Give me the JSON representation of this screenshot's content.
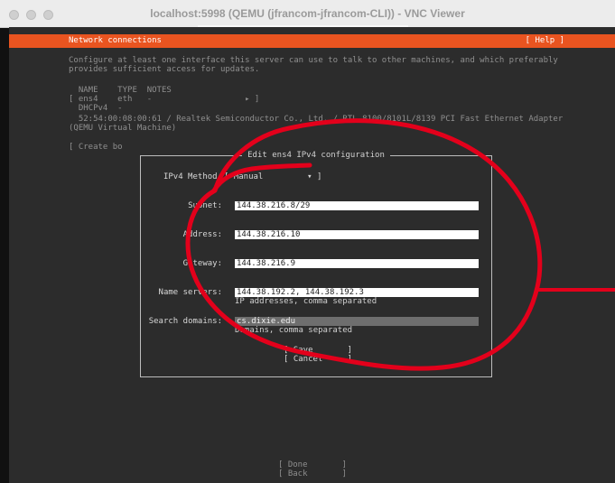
{
  "window": {
    "title": "localhost:5998 (QEMU (jfrancom-jfrancom-CLI)) - VNC Viewer"
  },
  "header": {
    "title": "Network connections",
    "help": "[ Help ]"
  },
  "intro": {
    "line1": "Configure at least one interface this server can use to talk to other machines, and which preferably",
    "line2": "provides sufficient access for updates."
  },
  "table": {
    "headers": "  NAME    TYPE  NOTES",
    "row1": "[ ens4    eth   -                   ▸ ]",
    "row2": "  DHCPv4  -",
    "row3": "  52:54:00:08:00:61 / Realtek Semiconductor Co., Ltd. / RTL-8100/8101L/8139 PCI Fast Ethernet Adapter",
    "row4": "(QEMU Virtual Machine)"
  },
  "create_bond": "[ Create bo",
  "dialog": {
    "title": "Edit ens4 IPv4 configuration",
    "method_label": "IPv4 Method:",
    "method_value": "[ Manual         ▾ ]",
    "subnet_label": "Subnet:",
    "subnet_value": "144.38.216.8/29",
    "address_label": "Address:",
    "address_value": "144.38.216.10",
    "gateway_label": "Gateway:",
    "gateway_value": "144.38.216.9",
    "nameservers_label": "Name servers:",
    "nameservers_value": "144.38.192.2, 144.38.192.3",
    "nameservers_hint": "IP addresses, comma separated",
    "search_label": "Search domains:",
    "search_value": "cs.dixie.edu",
    "search_hint": "Domains, comma separated",
    "save": "[ Save       ]",
    "cancel": "[ Cancel     ]"
  },
  "footer": {
    "done": "[ Done       ]",
    "back": "[ Back       ]"
  },
  "colors": {
    "header": "#e95420",
    "terminal_bg": "#2c2c2c",
    "annotation": "#e3001b"
  }
}
